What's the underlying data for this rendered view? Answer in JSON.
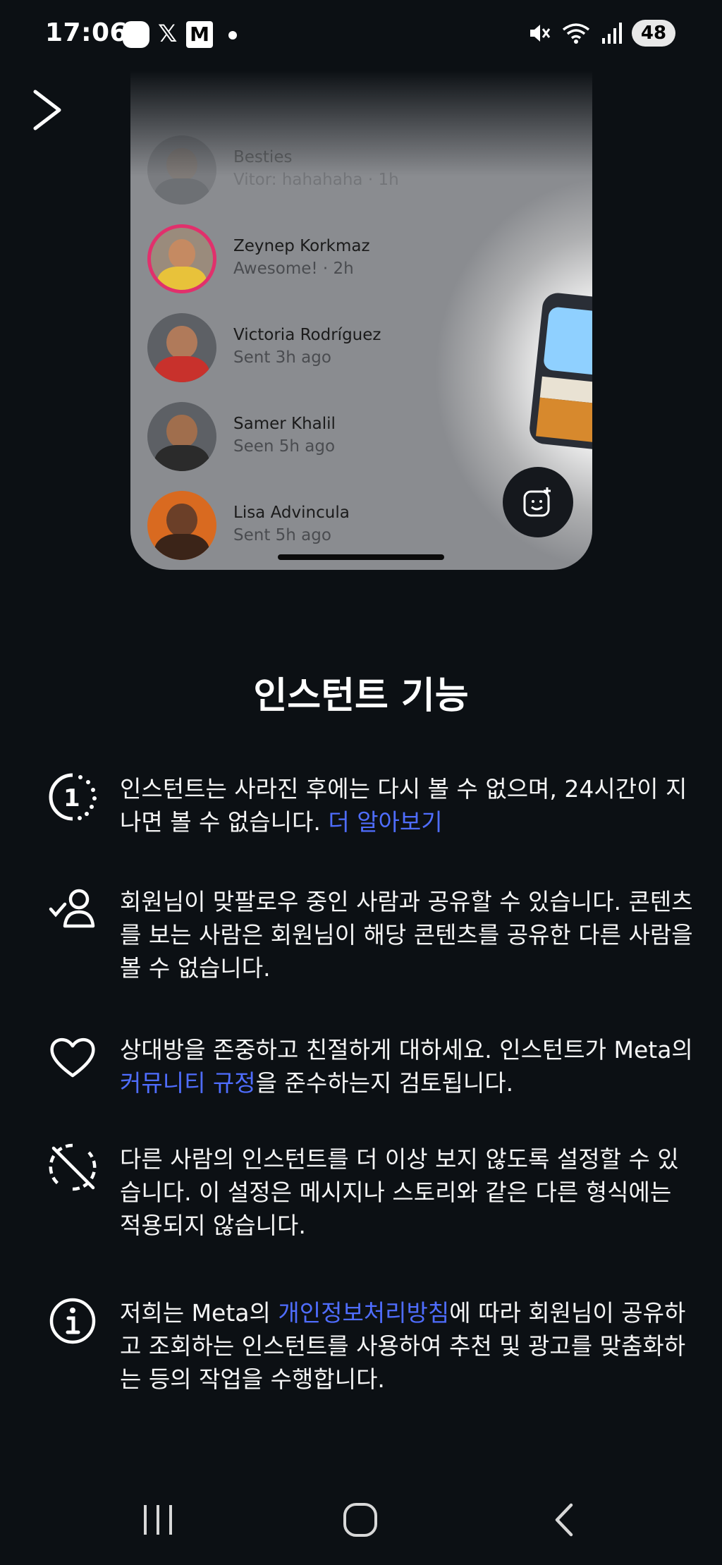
{
  "status_bar": {
    "time": "17:06",
    "battery": "48",
    "icons": [
      "app-icon",
      "x-icon",
      "medium-icon",
      "notification-dot",
      "mute-icon",
      "wifi-icon",
      "signal-icon"
    ]
  },
  "preview": {
    "threads": [
      {
        "name": "Besties",
        "sub": "Vitor: hahahaha · 1h"
      },
      {
        "name": "Zeynep Korkmaz",
        "sub": "Awesome! · 2h"
      },
      {
        "name": "Victoria Rodríguez",
        "sub": "Sent 3h ago"
      },
      {
        "name": "Samer Khalil",
        "sub": "Seen 5h ago"
      },
      {
        "name": "Lisa Advincula",
        "sub": "Sent 5h ago"
      }
    ]
  },
  "title": "인스턴트 기능",
  "features": [
    {
      "icon": "timer-one-icon",
      "text": "인스턴트는 사라진 후에는 다시 볼 수 없으며, 24시간이 지나면 볼 수 없습니다.",
      "link": "더 알아보기",
      "after": ""
    },
    {
      "icon": "mutual-follow-icon",
      "text": "회원님이 맞팔로우 중인 사람과 공유할 수 있습니다. 콘텐츠를 보는 사람은 회원님이 해당 콘텐츠를 공유한 다른 사람을 볼 수 없습니다.",
      "link": "",
      "after": ""
    },
    {
      "icon": "heart-icon",
      "text": "상대방을 존중하고 친절하게 대하세요. 인스턴트가 Meta의 ",
      "link": "커뮤니티 규정",
      "after": "을 준수하는지 검토됩니다."
    },
    {
      "icon": "hide-instants-icon",
      "text": "다른 사람의 인스턴트를 더 이상 보지 않도록 설정할 수 있습니다. 이 설정은 메시지나 스토리와 같은 다른 형식에는 적용되지 않습니다.",
      "link": "",
      "after": ""
    },
    {
      "icon": "info-icon",
      "text": "저희는 Meta의 ",
      "link": "개인정보처리방침",
      "after": "에 따라 회원님이 공유하고 조회하는 인스턴트를 사용하여 추천 및 광고를 맞춤화하는 등의 작업을 수행합니다."
    }
  ],
  "colors": {
    "background": "#0c1014",
    "link": "#4f6dff",
    "text": "#ffffff"
  }
}
